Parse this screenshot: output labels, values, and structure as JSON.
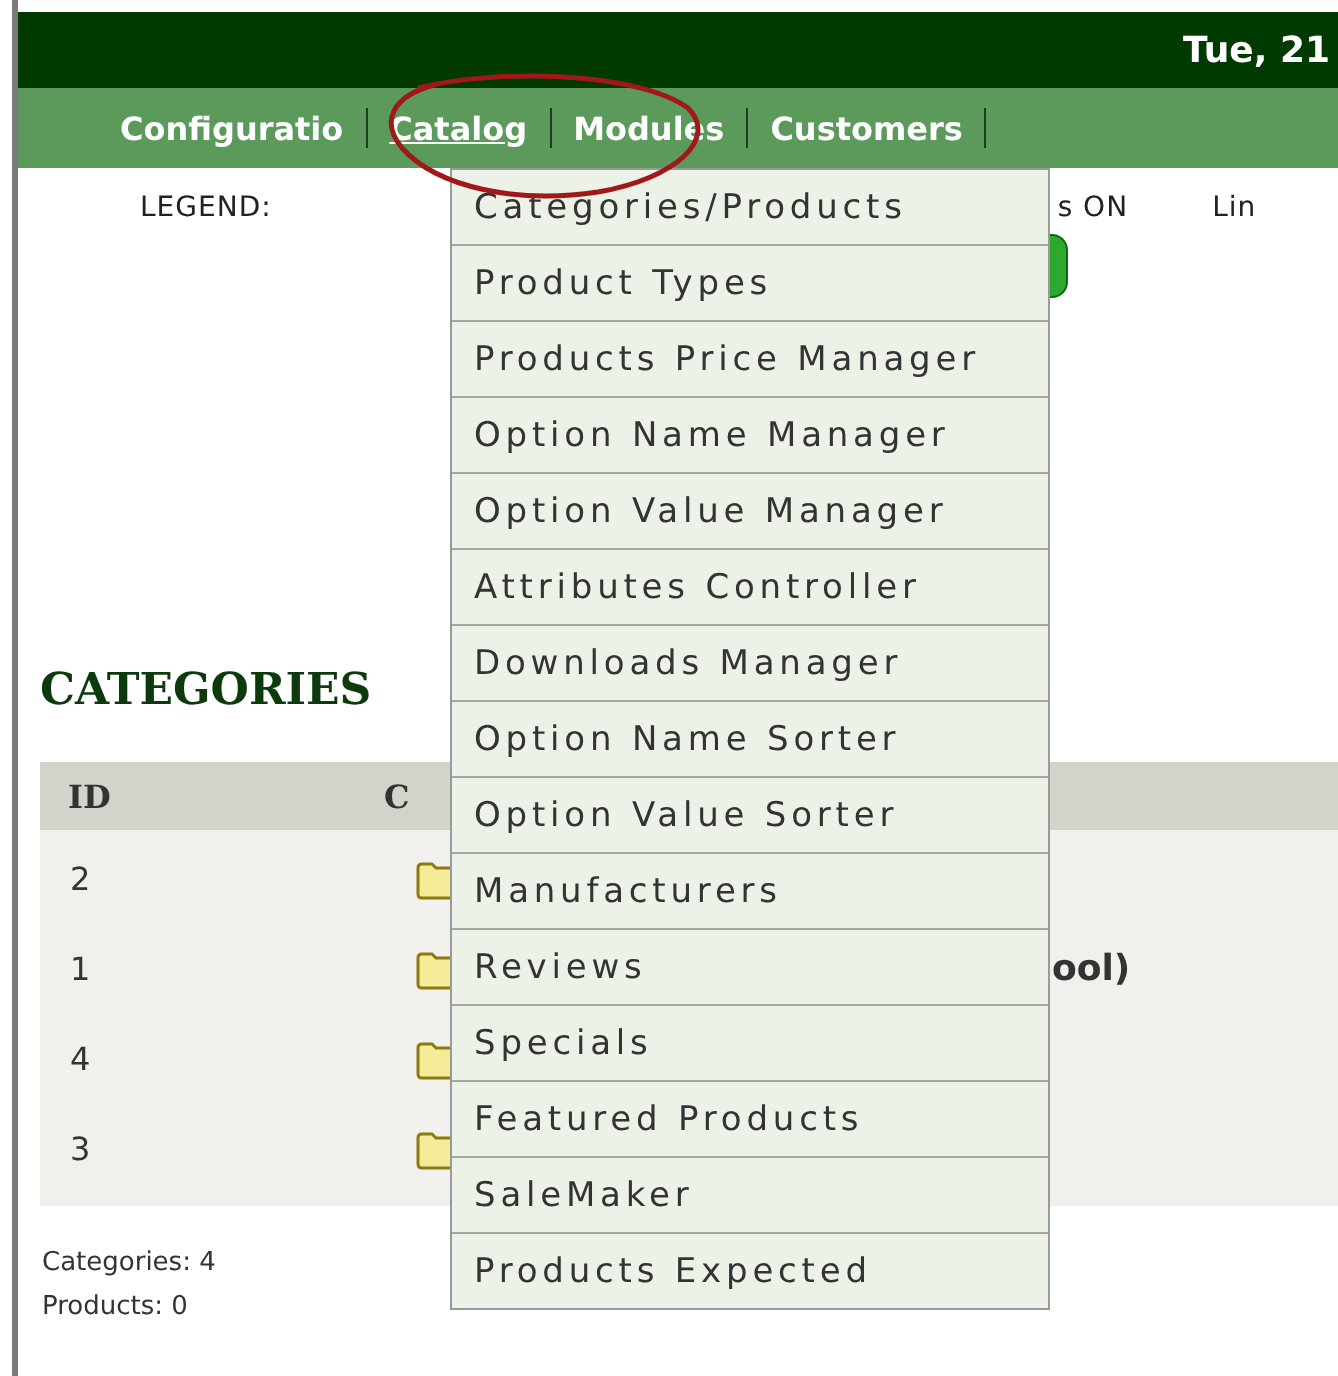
{
  "header": {
    "date": "Tue, 21"
  },
  "nav": [
    {
      "label": "Configuratio",
      "selected": false
    },
    {
      "label": "Catalog",
      "selected": true
    },
    {
      "label": "Modules",
      "selected": false
    },
    {
      "label": "Customers",
      "selected": false
    }
  ],
  "legend": {
    "label": "LEGEND:",
    "status_text": "s ON",
    "link_text": "Lin"
  },
  "menu": [
    "Categories/Products",
    "Product Types",
    "Products Price Manager",
    "Option Name Manager",
    "Option Value Manager",
    "Attributes Controller",
    "Downloads Manager",
    "Option Name Sorter",
    "Option Value Sorter",
    "Manufacturers",
    "Reviews",
    "Specials",
    "Featured Products",
    "SaleMaker",
    "Products Expected"
  ],
  "heading": "CATEGORIES",
  "table": {
    "columns": [
      "ID",
      "C"
    ],
    "rows": [
      {
        "id": "2",
        "name": ""
      },
      {
        "id": "1",
        "name": "ool)"
      },
      {
        "id": "4",
        "name": ""
      },
      {
        "id": "3",
        "name": ""
      }
    ]
  },
  "footer": [
    "Categories: 4",
    "Products: 0"
  ]
}
